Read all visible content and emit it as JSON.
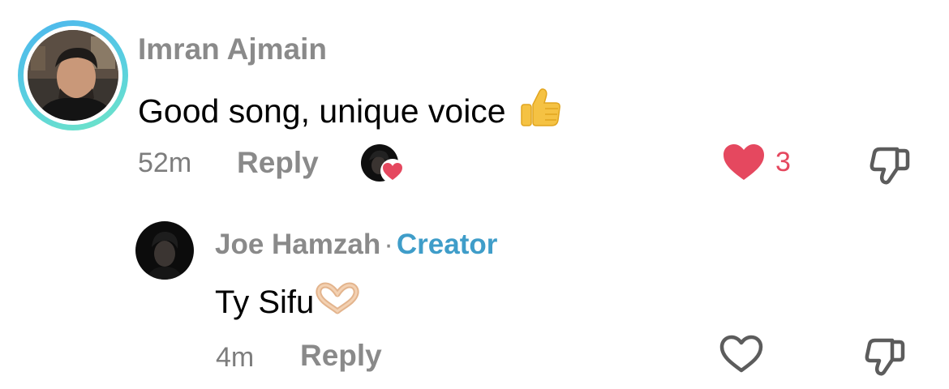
{
  "colors": {
    "name_gray": "#8a8a8a",
    "meta_gray": "#7d7d7d",
    "like_red": "#e5485f",
    "creator_blue": "#3f9dc9",
    "story_ring": "#4cb6ee"
  },
  "comment": {
    "author": "Imran Ajmain",
    "text": "Good song, unique voice",
    "text_emoji": "thumbs-up-emoji",
    "time": "52m",
    "reply_label": "Reply",
    "liked_by_creator": true,
    "like_count": "3",
    "liked": true,
    "icons": [
      "heart-filled-icon",
      "thumbs-down-icon"
    ]
  },
  "reply": {
    "author": "Joe Hamzah",
    "separator": "·",
    "badge": "Creator",
    "text": "Ty Sifu",
    "text_emoji": "heart-hands-emoji",
    "time": "4m",
    "reply_label": "Reply",
    "liked": false,
    "icons": [
      "heart-outline-icon",
      "thumbs-down-icon"
    ]
  }
}
